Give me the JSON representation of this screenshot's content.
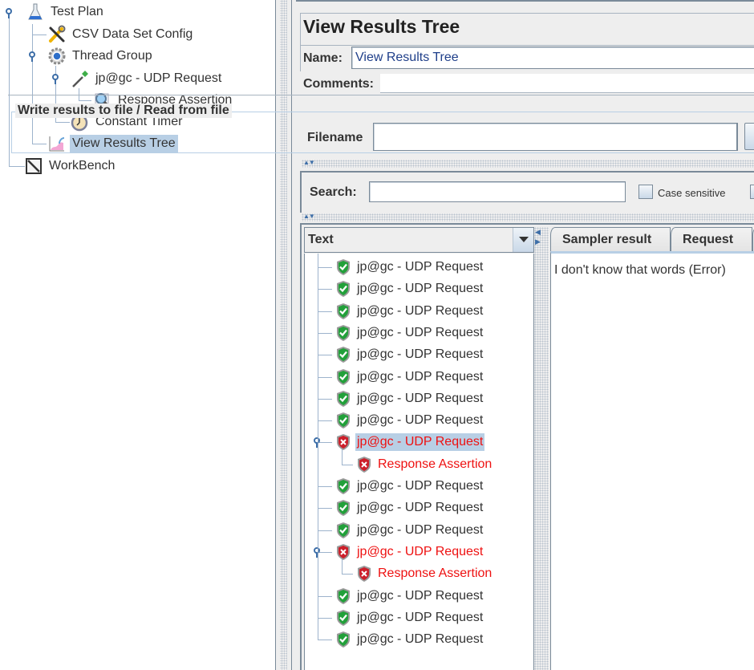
{
  "left_tree": {
    "nodes": [
      {
        "label": "Test Plan",
        "icon": "flask-icon"
      },
      {
        "label": "CSV Data Set Config",
        "icon": "tools-icon"
      },
      {
        "label": "Thread Group",
        "icon": "gear-icon"
      },
      {
        "label": "jp@gc - UDP Request",
        "icon": "pipette-icon"
      },
      {
        "label": "Response Assertion",
        "icon": "magnifier-icon"
      },
      {
        "label": "Constant Timer",
        "icon": "timer-icon"
      },
      {
        "label": "View Results Tree",
        "icon": "graph-icon",
        "selected": true
      },
      {
        "label": "WorkBench",
        "icon": "notepad-icon"
      }
    ]
  },
  "panel": {
    "title": "View Results Tree",
    "name_label": "Name:",
    "name_value": "View Results Tree",
    "comments_label": "Comments:",
    "comments_value": "",
    "file_group_label": "Write results to file / Read from file",
    "filename_label": "Filename",
    "filename_value": ""
  },
  "search": {
    "label": "Search:",
    "value": "",
    "case_sensitive_label": "Case sensitive",
    "case_sensitive_checked": false
  },
  "results": {
    "renderer_selected": "Text",
    "items": [
      {
        "label": "jp@gc - UDP Request",
        "status": "pass"
      },
      {
        "label": "jp@gc - UDP Request",
        "status": "pass"
      },
      {
        "label": "jp@gc - UDP Request",
        "status": "pass"
      },
      {
        "label": "jp@gc - UDP Request",
        "status": "pass"
      },
      {
        "label": "jp@gc - UDP Request",
        "status": "pass"
      },
      {
        "label": "jp@gc - UDP Request",
        "status": "pass"
      },
      {
        "label": "jp@gc - UDP Request",
        "status": "pass"
      },
      {
        "label": "jp@gc - UDP Request",
        "status": "pass"
      },
      {
        "label": "jp@gc - UDP Request",
        "status": "fail",
        "selected": true,
        "child": "Response Assertion"
      },
      {
        "label": "jp@gc - UDP Request",
        "status": "pass"
      },
      {
        "label": "jp@gc - UDP Request",
        "status": "pass"
      },
      {
        "label": "jp@gc - UDP Request",
        "status": "pass"
      },
      {
        "label": "jp@gc - UDP Request",
        "status": "fail",
        "child": "Response Assertion"
      },
      {
        "label": "jp@gc - UDP Request",
        "status": "pass"
      },
      {
        "label": "jp@gc - UDP Request",
        "status": "pass"
      },
      {
        "label": "jp@gc - UDP Request",
        "status": "pass"
      }
    ]
  },
  "detail": {
    "tabs": [
      {
        "label": "Sampler result",
        "active": false
      },
      {
        "label": "Request",
        "active": false
      }
    ],
    "response_text": "I don't know that words (Error)"
  },
  "colors": {
    "selection": "#b8cfe5",
    "fail_text": "#ee1111",
    "pass_icon": "#22a03a",
    "fail_icon": "#cc1f2a",
    "tree_line": "#9db3cc"
  }
}
